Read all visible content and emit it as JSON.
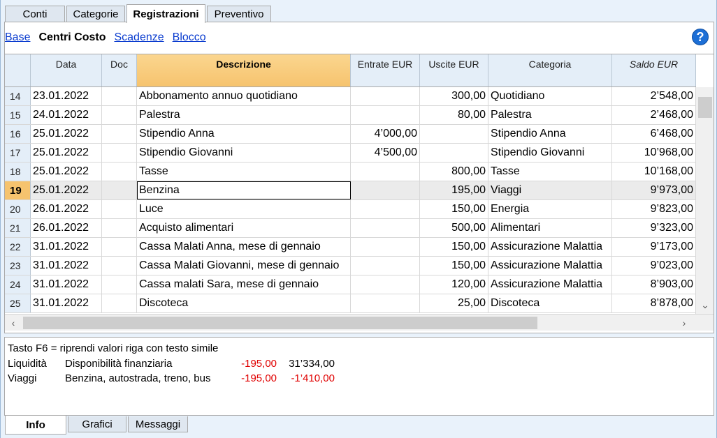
{
  "top_tabs": [
    "Conti",
    "Categorie",
    "Registrazioni",
    "Preventivo"
  ],
  "active_top_tab": "Registrazioni",
  "views": {
    "base": "Base",
    "centri_costo": "Centri Costo",
    "scadenze": "Scadenze",
    "blocco": "Blocco"
  },
  "help_icon_glyph": "?",
  "columns": {
    "date": "Data",
    "doc": "Doc",
    "desc": "Descrizione",
    "in": "Entrate EUR",
    "out": "Uscite EUR",
    "cat": "Categoria",
    "saldo": "Saldo EUR"
  },
  "rows": [
    {
      "n": "14",
      "date": "23.01.2022",
      "doc": "",
      "desc": "Abbonamento annuo quotidiano",
      "in": "",
      "out": "300,00",
      "cat": "Quotidiano",
      "saldo": "2’548,00"
    },
    {
      "n": "15",
      "date": "24.01.2022",
      "doc": "",
      "desc": "Palestra",
      "in": "",
      "out": "80,00",
      "cat": "Palestra",
      "saldo": "2’468,00"
    },
    {
      "n": "16",
      "date": "25.01.2022",
      "doc": "",
      "desc": "Stipendio Anna",
      "in": "4’000,00",
      "out": "",
      "cat": "Stipendio Anna",
      "saldo": "6’468,00"
    },
    {
      "n": "17",
      "date": "25.01.2022",
      "doc": "",
      "desc": "Stipendio Giovanni",
      "in": "4’500,00",
      "out": "",
      "cat": "Stipendio Giovanni",
      "saldo": "10’968,00"
    },
    {
      "n": "18",
      "date": "25.01.2022",
      "doc": "",
      "desc": "Tasse",
      "in": "",
      "out": "800,00",
      "cat": "Tasse",
      "saldo": "10’168,00"
    },
    {
      "n": "19",
      "date": "25.01.2022",
      "doc": "",
      "desc": "Benzina",
      "in": "",
      "out": "195,00",
      "cat": "Viaggi",
      "saldo": "9’973,00"
    },
    {
      "n": "20",
      "date": "26.01.2022",
      "doc": "",
      "desc": "Luce",
      "in": "",
      "out": "150,00",
      "cat": "Energia",
      "saldo": "9’823,00"
    },
    {
      "n": "21",
      "date": "26.01.2022",
      "doc": "",
      "desc": "Acquisto alimentari",
      "in": "",
      "out": "500,00",
      "cat": "Alimentari",
      "saldo": "9’323,00"
    },
    {
      "n": "22",
      "date": "31.01.2022",
      "doc": "",
      "desc": "Cassa Malati Anna, mese di gennaio",
      "in": "",
      "out": "150,00",
      "cat": "Assicurazione Malattia",
      "saldo": "9’173,00"
    },
    {
      "n": "23",
      "date": "31.01.2022",
      "doc": "",
      "desc": "Cassa Malati Giovanni, mese di gennaio",
      "in": "",
      "out": "150,00",
      "cat": "Assicurazione Malattia",
      "saldo": "9’023,00"
    },
    {
      "n": "24",
      "date": "31.01.2022",
      "doc": "",
      "desc": "Cassa malati Sara, mese di gennaio",
      "in": "",
      "out": "120,00",
      "cat": "Assicurazione Malattia",
      "saldo": "8’903,00"
    },
    {
      "n": "25",
      "date": "31.01.2022",
      "doc": "",
      "desc": "Discoteca",
      "in": "",
      "out": "25,00",
      "cat": "Discoteca",
      "saldo": "8’878,00"
    }
  ],
  "selected_row": "19",
  "info": {
    "hint": "Tasto F6 = riprendi valori riga con testo simile",
    "lines": [
      {
        "label": "Liquidità",
        "desc": "Disponibilità finanziaria",
        "amount": "-195,00",
        "balance": "31’334,00"
      },
      {
        "label": "Viaggi",
        "desc": "Benzina, autostrada, treno, bus",
        "amount": "-195,00",
        "balance": "-1’410,00"
      }
    ]
  },
  "bottom_tabs": [
    "Info",
    "Grafici",
    "Messaggi"
  ],
  "active_bottom_tab": "Info",
  "colors": {
    "accent_header": "#f6c36e",
    "link": "#0a3ccf",
    "negative": "#e00000",
    "help": "#1d6fd6"
  }
}
